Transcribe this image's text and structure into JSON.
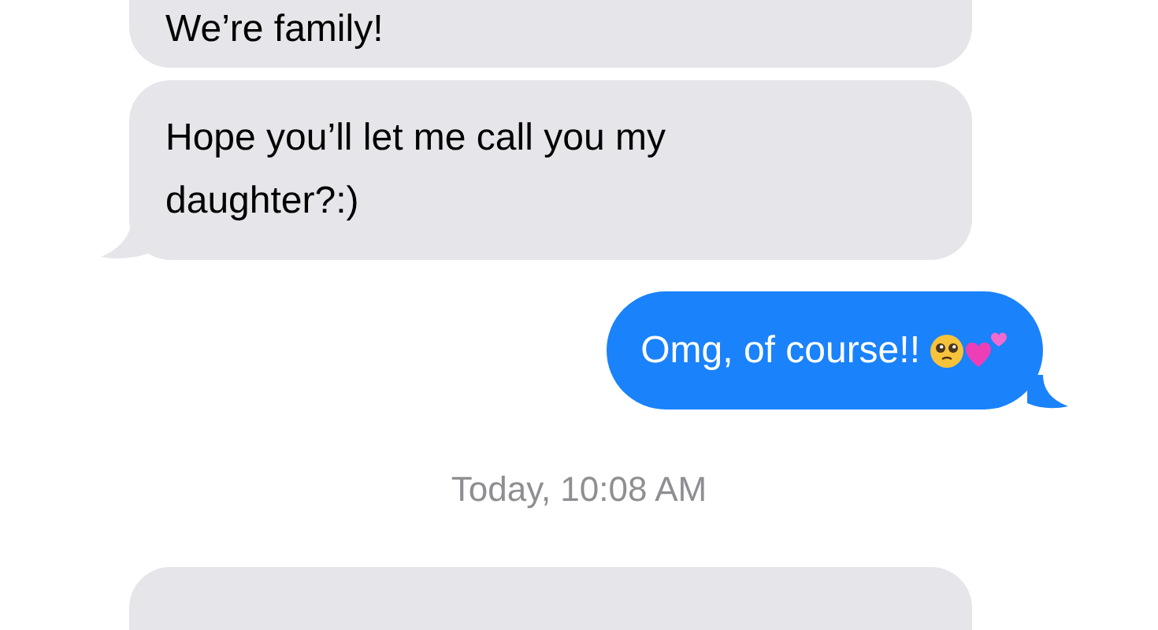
{
  "messages": [
    {
      "kind": "received",
      "text": "We’re family!"
    },
    {
      "kind": "received",
      "text": "Hope you’ll let me call you my daughter?:)",
      "tail": true
    },
    {
      "kind": "sent",
      "text": "Omg, of course!!",
      "emoji": true,
      "tail": true
    },
    {
      "kind": "timestamp",
      "text": "Today, 10:08 AM"
    },
    {
      "kind": "received"
    }
  ]
}
